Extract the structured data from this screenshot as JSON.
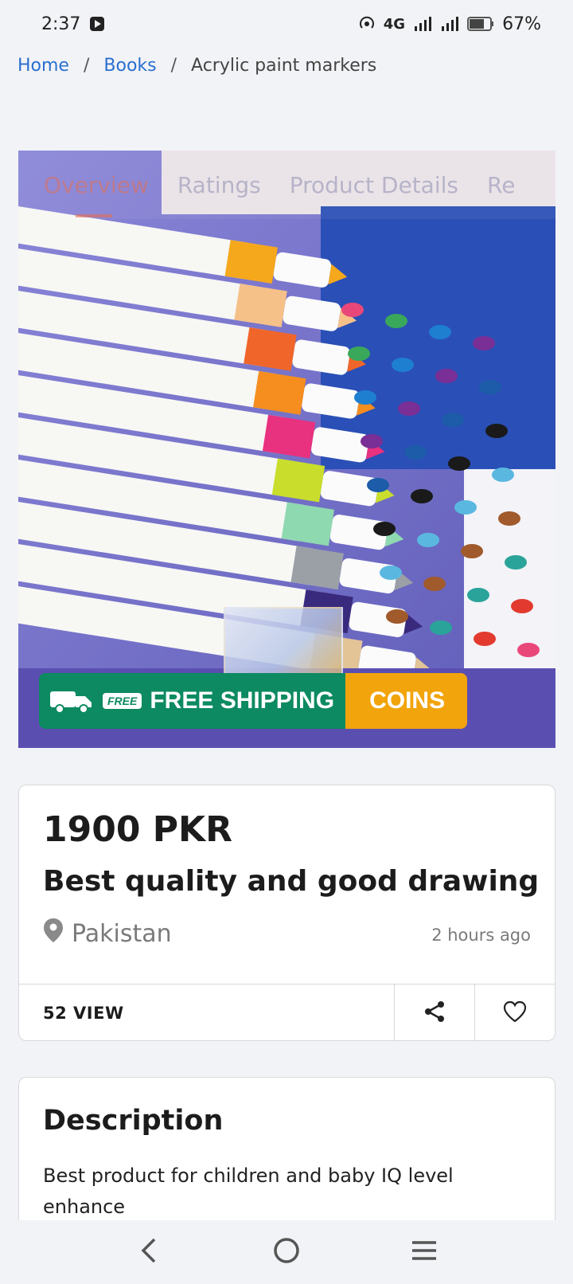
{
  "status": {
    "time": "2:37",
    "network": "4G",
    "battery": "67%"
  },
  "breadcrumb": {
    "home": "Home",
    "category": "Books",
    "current": "Acrylic paint markers"
  },
  "hero": {
    "overlay_tabs": [
      "Overview",
      "Ratings",
      "Product Details",
      "Re"
    ],
    "badge_free": "FREE",
    "badge_shipping": "FREE SHIPPING",
    "badge_coins": "COINS",
    "marker_colors": [
      "#f5a81c",
      "#f6c089",
      "#f0662a",
      "#f58e1e",
      "#e8317f",
      "#c9de2c",
      "#8fd9b0",
      "#9aa0a6",
      "#3a2a7d",
      "#e2c497"
    ],
    "tip_colors": [
      "#e9477a",
      "#3aa85a",
      "#1e7fd1",
      "#7a2f96",
      "#1c5ca8",
      "#1a1a1a",
      "#5ab8e0",
      "#a05a2c",
      "#2aa39a",
      "#e23a2e"
    ]
  },
  "product": {
    "price": "1900 PKR",
    "title": "Best quality and good drawing",
    "location": "Pakistan",
    "posted": "2 hours ago",
    "views": "52 VIEW"
  },
  "description": {
    "heading": "Description",
    "text": "Best product for children and baby IQ level enhance"
  },
  "colors": {
    "link": "#2a6fd0",
    "ship_green": "#0d8a61",
    "ship_orange": "#f2a40c"
  }
}
